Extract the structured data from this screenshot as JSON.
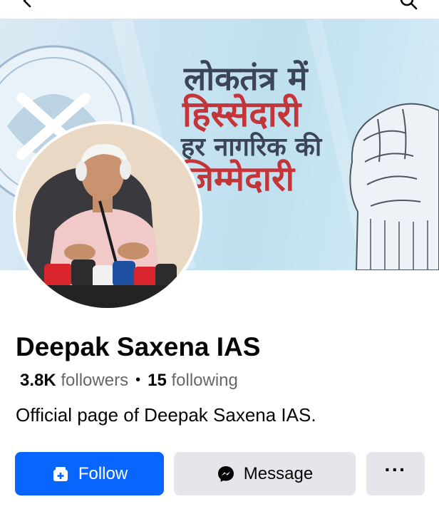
{
  "topbar": {
    "back_icon": "back-arrow-icon",
    "search_icon": "search-icon"
  },
  "cover": {
    "lines": [
      "लोकतंत्र में",
      "हिस्सेदारी",
      "हर नागरिक की",
      "जिम्मेदारी"
    ],
    "colors": {
      "dark": "#3c4558",
      "red": "#c4353a",
      "background": "#c9e3f1"
    }
  },
  "profile": {
    "name": "Deepak Saxena IAS",
    "followers_count": "3.8K",
    "followers_label": "followers",
    "separator": "•",
    "following_count": "15",
    "following_label": "following",
    "bio": "Official page of Deepak Saxena IAS."
  },
  "actions": {
    "follow_label": "Follow",
    "message_label": "Message",
    "more_label": "···"
  },
  "colors": {
    "primary": "#0866ff",
    "secondary_button": "#e4e6eb",
    "muted_text": "#65676b"
  }
}
